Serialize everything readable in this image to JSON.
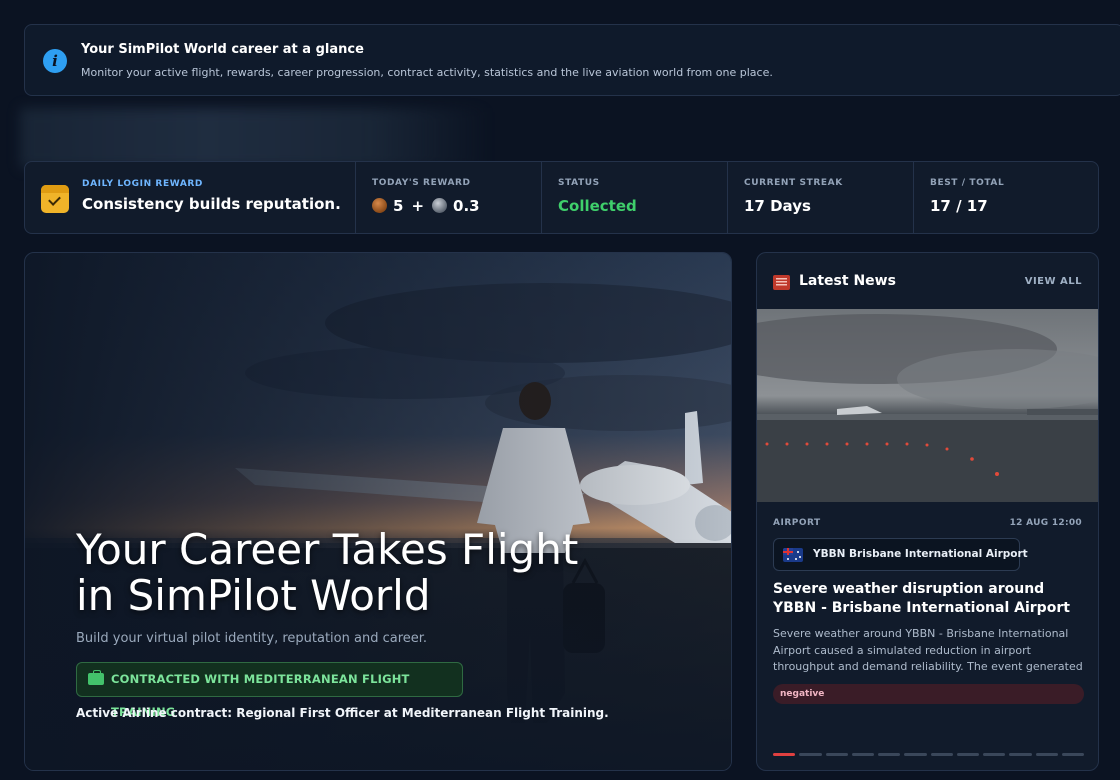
{
  "banner": {
    "icon": "info-icon",
    "title": "Your SimPilot World career at a glance",
    "subtitle": "Monitor your active flight, rewards, career progression, contract activity, statistics and the live aviation world from one place."
  },
  "daily_reward": {
    "icon": "calendar-check-icon",
    "label": "DAILY LOGIN REWARD",
    "tagline": "Consistency builds reputation.",
    "today_label": "TODAY'S REWARD",
    "today_primary": "5",
    "today_plus": "+",
    "today_secondary": "0.3",
    "status_label": "STATUS",
    "status_value": "Collected",
    "status_color": "#3fcf6b",
    "streak_label": "CURRENT STREAK",
    "streak_value": "17 Days",
    "best_label": "BEST / TOTAL",
    "best_value": "17 / 17"
  },
  "hero": {
    "title_line1": "Your Career Takes Flight",
    "title_line2": "in SimPilot World",
    "subtitle": "Build your virtual pilot identity, reputation and career.",
    "contract_badge": "CONTRACTED WITH MEDITERRANEAN FLIGHT TRAINING",
    "contract_badge_color": "#7ce49b",
    "contract_text": "Active Airline contract: Regional First Officer at Mediterranean Flight Training."
  },
  "news": {
    "icon": "newspaper-icon",
    "title": "Latest News",
    "view_all": "VIEW ALL",
    "item": {
      "category": "AIRPORT",
      "date": "12 AUG 12:00",
      "airport_chip": "YBBN Brisbane International Airport",
      "flag": "australia-flag-icon",
      "headline": "Severe weather disruption around YBBN - Brisbane International Airport",
      "summary": "Severe weather around YBBN - Brisbane International Airport caused a simulated reduction in airport throughput and demand reliability. The event generated ...",
      "sentiment": "negative",
      "sentiment_color": "#3a1c27"
    },
    "carousel_count": 12,
    "carousel_active": 1,
    "accent_color": "#e04040"
  }
}
